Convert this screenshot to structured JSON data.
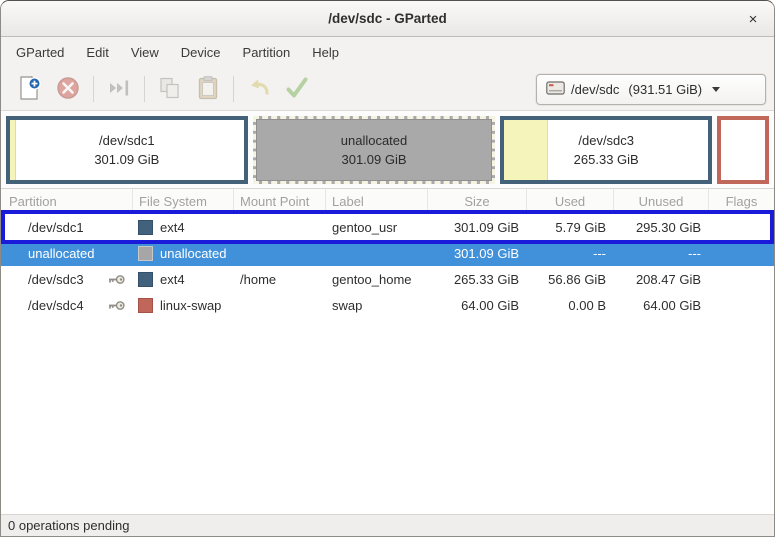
{
  "window": {
    "title": "/dev/sdc - GParted",
    "close_glyph": "×"
  },
  "menubar": {
    "items": [
      {
        "label": "GParted"
      },
      {
        "label": "Edit"
      },
      {
        "label": "View"
      },
      {
        "label": "Device"
      },
      {
        "label": "Partition"
      },
      {
        "label": "Help"
      }
    ]
  },
  "toolbar": {
    "buttons": [
      {
        "name": "new-partition",
        "enabled": true
      },
      {
        "name": "delete-partition",
        "enabled": false
      },
      {
        "name": "resize-move",
        "enabled": false
      },
      {
        "name": "copy",
        "enabled": false
      },
      {
        "name": "paste",
        "enabled": false
      },
      {
        "name": "undo",
        "enabled": false
      },
      {
        "name": "apply",
        "enabled": false
      }
    ],
    "device_selector": {
      "device": "/dev/sdc",
      "size": "(931.51 GiB)"
    }
  },
  "disk_visual": {
    "segments": [
      {
        "name": "/dev/sdc1",
        "size": "301.09 GiB",
        "filesystem": "ext4",
        "selected": false
      },
      {
        "name": "unallocated",
        "size": "301.09 GiB",
        "filesystem": "unallocated",
        "selected": true
      },
      {
        "name": "/dev/sdc3",
        "size": "265.33 GiB",
        "filesystem": "ext4",
        "selected": false
      },
      {
        "name": "",
        "size": "",
        "filesystem": "linux-swap",
        "selected": false
      }
    ]
  },
  "table": {
    "headers": [
      "Partition",
      "File System",
      "Mount Point",
      "Label",
      "Size",
      "Used",
      "Unused",
      "Flags"
    ],
    "rows": [
      {
        "partition": "/dev/sdc1",
        "fs": "ext4",
        "mount": "",
        "label": "gentoo_usr",
        "size": "301.09 GiB",
        "used": "5.79 GiB",
        "unused": "295.30 GiB",
        "flags": "",
        "locked": false,
        "selected": false,
        "highlighted": true
      },
      {
        "partition": "unallocated",
        "fs": "unallocated",
        "mount": "",
        "label": "",
        "size": "301.09 GiB",
        "used": "---",
        "unused": "---",
        "flags": "",
        "locked": false,
        "selected": true,
        "highlighted": false
      },
      {
        "partition": "/dev/sdc3",
        "fs": "ext4",
        "mount": "/home",
        "label": "gentoo_home",
        "size": "265.33 GiB",
        "used": "56.86 GiB",
        "unused": "208.47 GiB",
        "flags": "",
        "locked": true,
        "selected": false,
        "highlighted": false
      },
      {
        "partition": "/dev/sdc4",
        "fs": "linux-swap",
        "mount": "",
        "label": "swap",
        "size": "64.00 GiB",
        "used": "0.00 B",
        "unused": "64.00 GiB",
        "flags": "",
        "locked": true,
        "selected": false,
        "highlighted": false
      }
    ]
  },
  "statusbar": {
    "text": "0 operations pending"
  },
  "colors": {
    "ext4": "#41617d",
    "linux_swap": "#c1665a",
    "unallocated": "#a6a6a6",
    "selection_blue": "#4191da",
    "highlight_border": "#1a1ada",
    "used_fill": "#f5f5bb"
  }
}
